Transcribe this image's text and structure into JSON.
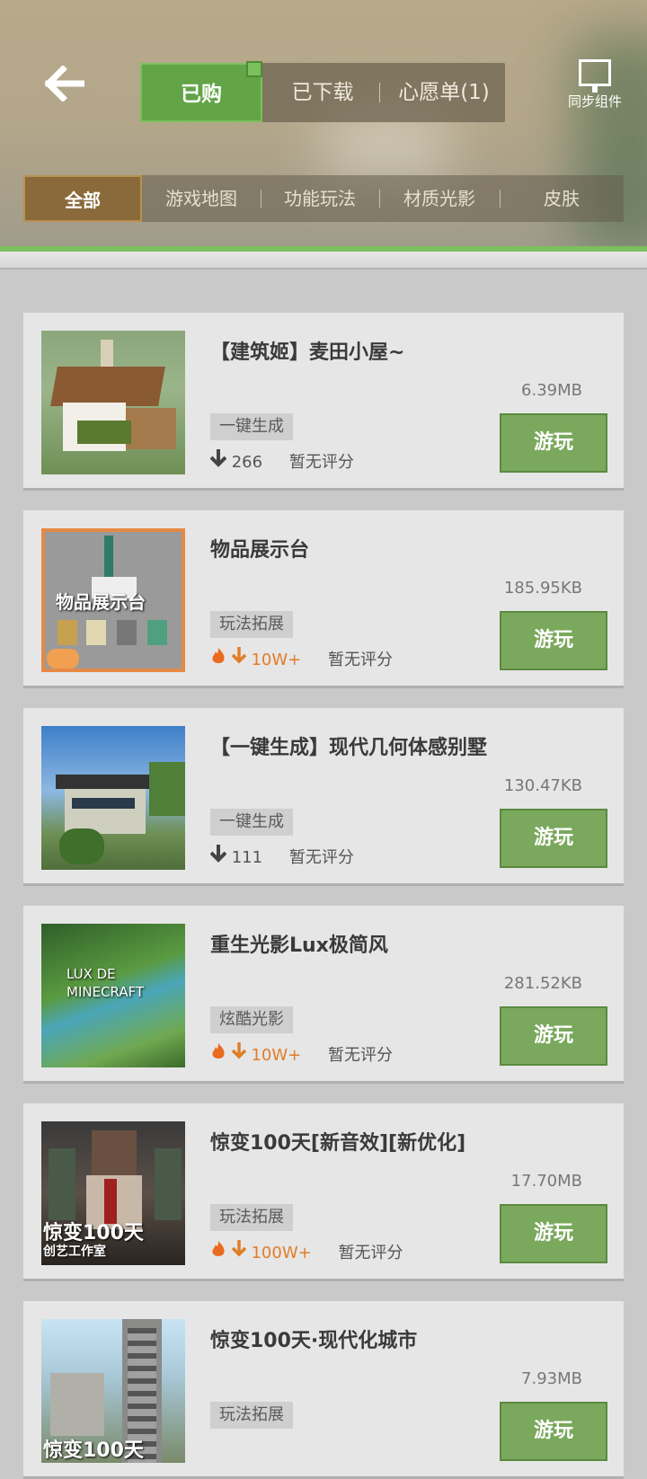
{
  "header": {
    "tabs": [
      {
        "label": "已购"
      },
      {
        "label": "已下载"
      },
      {
        "label": "心愿单(1)"
      }
    ],
    "sync_label": "同步组件"
  },
  "categories": [
    {
      "label": "全部"
    },
    {
      "label": "游戏地图"
    },
    {
      "label": "功能玩法"
    },
    {
      "label": "材质光影"
    },
    {
      "label": "皮肤"
    }
  ],
  "items": [
    {
      "title": "【建筑姬】麦田小屋~",
      "size": "6.39MB",
      "tag": "一键生成",
      "downloads": "266",
      "hot": false,
      "rating": "暂无评分",
      "play": "游玩"
    },
    {
      "title": "物品展示台",
      "size": "185.95KB",
      "tag": "玩法拓展",
      "downloads": "10W+",
      "hot": true,
      "rating": "暂无评分",
      "play": "游玩",
      "thumb_text": "物品展示台"
    },
    {
      "title": "【一键生成】现代几何体感别墅",
      "size": "130.47KB",
      "tag": "一键生成",
      "downloads": "111",
      "hot": false,
      "rating": "暂无评分",
      "play": "游玩"
    },
    {
      "title": "重生光影Lux极简风",
      "size": "281.52KB",
      "tag": "炫酷光影",
      "downloads": "10W+",
      "hot": true,
      "rating": "暂无评分",
      "play": "游玩",
      "thumb_text": "LUX DE MINECRAFT"
    },
    {
      "title": "惊变100天[新音效][新优化]",
      "size": "17.70MB",
      "tag": "玩法拓展",
      "downloads": "100W+",
      "hot": true,
      "rating": "暂无评分",
      "play": "游玩",
      "thumb_text": "惊变100天",
      "thumb_sub": "创艺工作室"
    },
    {
      "title": "惊变100天·现代化城市",
      "size": "7.93MB",
      "tag": "玩法拓展",
      "downloads": "",
      "hot": false,
      "rating": "",
      "play": "游玩",
      "thumb_text": "惊变100天"
    }
  ]
}
